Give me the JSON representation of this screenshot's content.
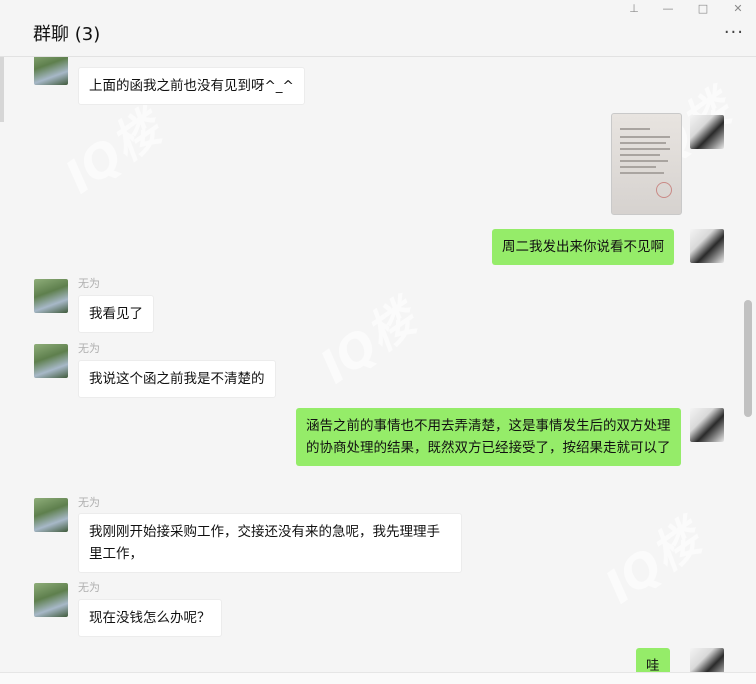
{
  "header": {
    "title": "群聊 (3)",
    "more_label": "···"
  },
  "window_controls": {
    "pin": "⊥",
    "minimize": "—",
    "maximize": "□",
    "close": "✕"
  },
  "watermark_text": "IQ楼",
  "messages": [
    {
      "side": "left",
      "text": "上面的函我之前也没有见到呀^_^"
    },
    {
      "side": "right",
      "type": "image",
      "icon": "document-image"
    },
    {
      "side": "right",
      "text": "周二我发出来你说看不见啊"
    },
    {
      "side": "left",
      "sender": "无为",
      "text": "我看见了"
    },
    {
      "side": "left",
      "sender": "无为",
      "text": "我说这个函之前我是不清楚的"
    },
    {
      "side": "right",
      "text": "涵告之前的事情也不用去弄清楚，这是事情发生后的双方处理的协商处理的结果，既然双方已经接受了，按绍果走就可以了"
    },
    {
      "side": "left",
      "sender": "无为",
      "text": "我刚刚开始接采购工作，交接还没有来的急呢，我先理理手里工作，"
    },
    {
      "side": "left",
      "sender": "无为",
      "text": "现在没钱怎么办呢？"
    },
    {
      "side": "right",
      "text": "哇"
    }
  ],
  "colors": {
    "sent_bubble": "#95ec69",
    "received_bubble": "#ffffff",
    "background": "#f5f5f5"
  }
}
